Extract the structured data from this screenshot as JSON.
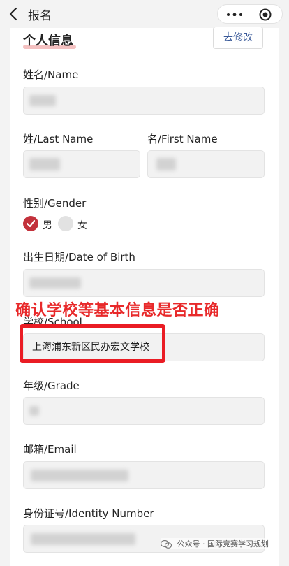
{
  "nav": {
    "title": "报名"
  },
  "section": {
    "title": "个人信息",
    "edit_label": "去修改"
  },
  "fields": {
    "name": {
      "label": "姓名/Name"
    },
    "last_name": {
      "label": "姓/Last Name"
    },
    "first_name": {
      "label": "名/First Name"
    },
    "gender": {
      "label": "性别/Gender",
      "options": [
        "男",
        "女"
      ],
      "selected": "男"
    },
    "dob": {
      "label": "出生日期/Date of Birth"
    },
    "school": {
      "label": "学校/School",
      "value": "上海浦东新区民办宏文学校"
    },
    "grade": {
      "label": "年级/Grade"
    },
    "email": {
      "label": "邮箱/Email"
    },
    "id_number": {
      "label": "身份证号/Identity Number"
    }
  },
  "annotation": {
    "text": "确认学校等基本信息是否正确",
    "color": "#e8292a"
  },
  "watermark": {
    "text": "公众号 · 国际竞赛学习规划"
  },
  "colors": {
    "accent": "#c3313b",
    "highlight": "#ea1c24"
  }
}
